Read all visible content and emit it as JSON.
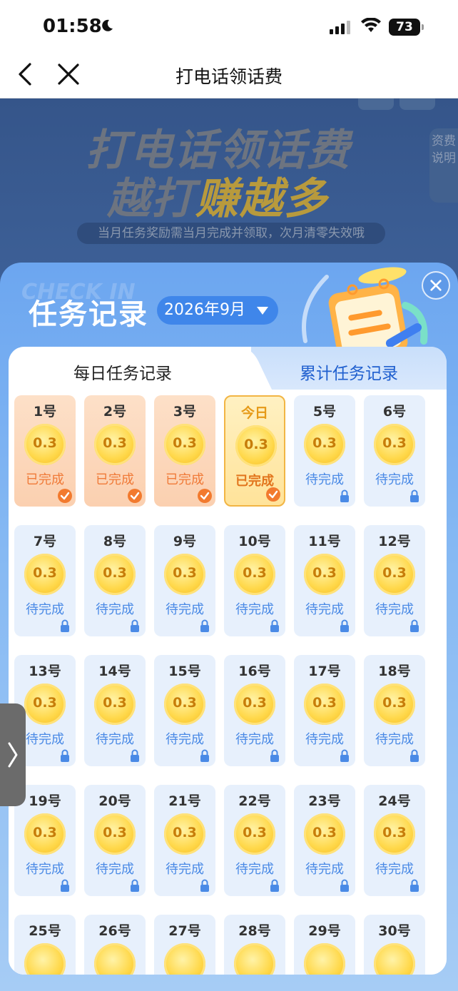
{
  "status_bar": {
    "time": "01:58",
    "battery": "73"
  },
  "nav": {
    "title": "打电话领话费"
  },
  "banner": {
    "line1": "打电话领话费",
    "line2_prefix": "越打",
    "line2_highlight": "赚越多",
    "subtitle": "当月任务奖励需当月完成并领取，次月清零失效哦",
    "side_label": "资费说明"
  },
  "sheet": {
    "watermark": "CHECK IN",
    "title": "任务记录",
    "month": "2026年9月",
    "tabs": {
      "daily": "每日任务记录",
      "total": "累计任务记录"
    }
  },
  "days": [
    {
      "label": "1号",
      "amount": "0.3",
      "status": "已完成",
      "state": "done"
    },
    {
      "label": "2号",
      "amount": "0.3",
      "status": "已完成",
      "state": "done"
    },
    {
      "label": "3号",
      "amount": "0.3",
      "status": "已完成",
      "state": "done"
    },
    {
      "label": "今日",
      "amount": "0.3",
      "status": "已完成",
      "state": "today"
    },
    {
      "label": "5号",
      "amount": "0.3",
      "status": "待完成",
      "state": "locked"
    },
    {
      "label": "6号",
      "amount": "0.3",
      "status": "待完成",
      "state": "locked"
    },
    {
      "label": "7号",
      "amount": "0.3",
      "status": "待完成",
      "state": "locked"
    },
    {
      "label": "8号",
      "amount": "0.3",
      "status": "待完成",
      "state": "locked"
    },
    {
      "label": "9号",
      "amount": "0.3",
      "status": "待完成",
      "state": "locked"
    },
    {
      "label": "10号",
      "amount": "0.3",
      "status": "待完成",
      "state": "locked"
    },
    {
      "label": "11号",
      "amount": "0.3",
      "status": "待完成",
      "state": "locked"
    },
    {
      "label": "12号",
      "amount": "0.3",
      "status": "待完成",
      "state": "locked"
    },
    {
      "label": "13号",
      "amount": "0.3",
      "status": "待完成",
      "state": "locked"
    },
    {
      "label": "14号",
      "amount": "0.3",
      "status": "待完成",
      "state": "locked"
    },
    {
      "label": "15号",
      "amount": "0.3",
      "status": "待完成",
      "state": "locked"
    },
    {
      "label": "16号",
      "amount": "0.3",
      "status": "待完成",
      "state": "locked"
    },
    {
      "label": "17号",
      "amount": "0.3",
      "status": "待完成",
      "state": "locked"
    },
    {
      "label": "18号",
      "amount": "0.3",
      "status": "待完成",
      "state": "locked"
    },
    {
      "label": "19号",
      "amount": "0.3",
      "status": "待完成",
      "state": "locked"
    },
    {
      "label": "20号",
      "amount": "0.3",
      "status": "待完成",
      "state": "locked"
    },
    {
      "label": "21号",
      "amount": "0.3",
      "status": "待完成",
      "state": "locked"
    },
    {
      "label": "22号",
      "amount": "0.3",
      "status": "待完成",
      "state": "locked"
    },
    {
      "label": "23号",
      "amount": "0.3",
      "status": "待完成",
      "state": "locked"
    },
    {
      "label": "24号",
      "amount": "0.3",
      "status": "待完成",
      "state": "locked"
    },
    {
      "label": "25号",
      "amount": "",
      "status": "",
      "state": "locked"
    },
    {
      "label": "26号",
      "amount": "",
      "status": "",
      "state": "locked"
    },
    {
      "label": "27号",
      "amount": "",
      "status": "",
      "state": "locked"
    },
    {
      "label": "28号",
      "amount": "",
      "status": "",
      "state": "locked"
    },
    {
      "label": "29号",
      "amount": "",
      "status": "",
      "state": "locked"
    },
    {
      "label": "30号",
      "amount": "",
      "status": "",
      "state": "locked"
    }
  ]
}
